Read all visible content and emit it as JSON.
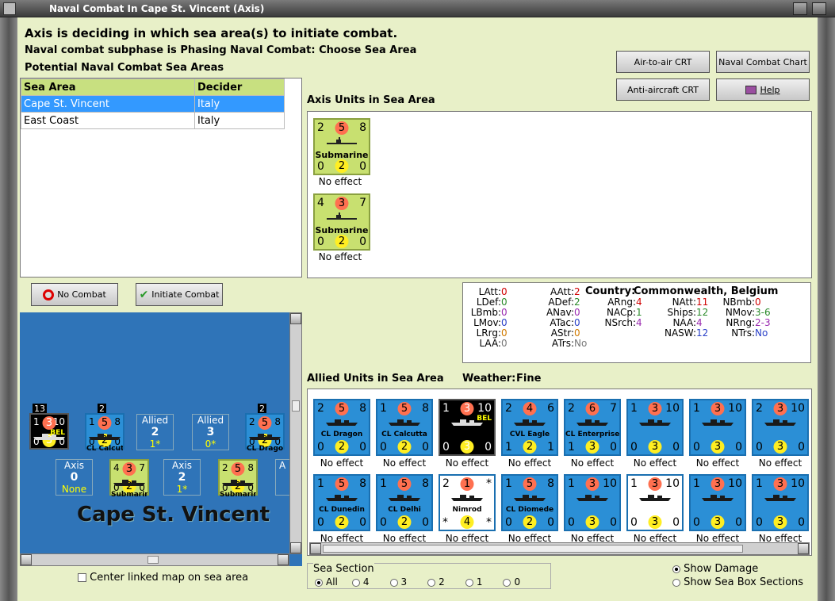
{
  "window": {
    "title": "Naval Combat In Cape St. Vincent (Axis)"
  },
  "header": {
    "line1": "Axis is deciding in which sea area(s) to initiate combat.",
    "line2": "Naval combat subphase is Phasing Naval Combat: Choose Sea Area",
    "line3": "Potential Naval Combat Sea Areas"
  },
  "buttons": {
    "air_to_air": "Air-to-air CRT",
    "naval_chart": "Naval Combat Chart",
    "anti_aircraft": "Anti-aircraft CRT",
    "help": "Help",
    "no_combat": "No Combat",
    "initiate_combat": "Initiate Combat"
  },
  "sea_table": {
    "headers": [
      "Sea Area",
      "Decider"
    ],
    "rows": [
      [
        "Cape St. Vincent",
        "Italy"
      ],
      [
        "East Coast",
        "Italy"
      ]
    ]
  },
  "axis_units": {
    "title": "Axis Units in Sea Area",
    "units": [
      {
        "tl": "2",
        "c": "5",
        "tr": "8",
        "name": "Submarine",
        "bl": "0",
        "cb": "2",
        "br": "0",
        "effect": "No effect"
      },
      {
        "tl": "4",
        "c": "3",
        "tr": "7",
        "name": "Submarine",
        "bl": "0",
        "cb": "2",
        "br": "0",
        "effect": "No effect"
      }
    ]
  },
  "stats": {
    "country_label": "Country:",
    "country": "Commonwealth, Belgium",
    "col1": [
      [
        "LAtt:",
        "0"
      ],
      [
        "LDef:",
        "0"
      ],
      [
        "LBmb:",
        "0"
      ],
      [
        "LMov:",
        "0"
      ],
      [
        "LRrg:",
        "0"
      ],
      [
        "LAA:",
        "0"
      ]
    ],
    "col2": [
      [
        "AAtt:",
        "2"
      ],
      [
        "ADef:",
        "2"
      ],
      [
        "ANav:",
        "0"
      ],
      [
        "ATac:",
        "0"
      ],
      [
        "AStr:",
        "0"
      ],
      [
        "ATrs:",
        "No"
      ]
    ],
    "col3": [
      [
        "ARng:",
        "4"
      ],
      [
        "NACp:",
        "1"
      ],
      [
        "NSrch:",
        "4"
      ]
    ],
    "col4": [
      [
        "NAtt:",
        "11"
      ],
      [
        "Ships:",
        "12"
      ],
      [
        "NAA:",
        "4"
      ],
      [
        "NASW:",
        "12"
      ]
    ],
    "col5": [
      [
        "NBmb:",
        "0"
      ],
      [
        "NMov:",
        "3-6"
      ],
      [
        "NRng:",
        "2-3"
      ],
      [
        "NTrs:",
        "No"
      ]
    ]
  },
  "allied": {
    "title": "Allied Units in Sea Area",
    "weather_label": "Weather:",
    "weather": "Fine",
    "row1": [
      {
        "tl": "2",
        "c": "5",
        "tr": "8",
        "name": "CL Dragon",
        "bl": "0",
        "cb": "2",
        "br": "0",
        "effect": "No effect",
        "style": "blue"
      },
      {
        "tl": "1",
        "c": "5",
        "tr": "8",
        "name": "CL Calcutta",
        "bl": "0",
        "cb": "2",
        "br": "0",
        "effect": "No effect",
        "style": "blue"
      },
      {
        "tl": "1",
        "c": "3",
        "tr": "10",
        "name": "BEL",
        "bl": "0",
        "cb": "3",
        "br": "0",
        "effect": "No effect",
        "style": "dark"
      },
      {
        "tl": "2",
        "c": "4",
        "tr": "6",
        "name": "CVL Eagle",
        "bl": "1",
        "cb": "2",
        "br": "1",
        "effect": "No effect",
        "style": "blue"
      },
      {
        "tl": "2",
        "c": "6",
        "tr": "7",
        "name": "CL Enterprise",
        "bl": "1",
        "cb": "3",
        "br": "0",
        "effect": "No effect",
        "style": "blue"
      },
      {
        "tl": "1",
        "c": "3",
        "tr": "10",
        "name": "",
        "bl": "0",
        "cb": "3",
        "br": "0",
        "effect": "No effect",
        "style": "blue"
      },
      {
        "tl": "1",
        "c": "3",
        "tr": "10",
        "name": "",
        "bl": "0",
        "cb": "3",
        "br": "0",
        "effect": "No effect",
        "style": "blue"
      },
      {
        "tl": "2",
        "c": "3",
        "tr": "10",
        "name": "",
        "bl": "0",
        "cb": "3",
        "br": "0",
        "effect": "No effect",
        "style": "blue"
      }
    ],
    "row2": [
      {
        "tl": "1",
        "c": "5",
        "tr": "8",
        "name": "CL Dunedin",
        "bl": "0",
        "cb": "2",
        "br": "0",
        "effect": "No effect",
        "style": "blue"
      },
      {
        "tl": "1",
        "c": "5",
        "tr": "8",
        "name": "CL Delhi",
        "bl": "0",
        "cb": "2",
        "br": "0",
        "effect": "No effect",
        "style": "blue"
      },
      {
        "tl": "2",
        "c": "1",
        "tr": "*",
        "name": "Nimrod",
        "bl": "*",
        "cb": "4",
        "br": "*",
        "effect": "No effect",
        "style": "white"
      },
      {
        "tl": "1",
        "c": "5",
        "tr": "8",
        "name": "CL Diomede",
        "bl": "0",
        "cb": "2",
        "br": "0",
        "effect": "No effect",
        "style": "blue"
      },
      {
        "tl": "1",
        "c": "3",
        "tr": "10",
        "name": "",
        "bl": "0",
        "cb": "3",
        "br": "0",
        "effect": "No effect",
        "style": "blue"
      },
      {
        "tl": "1",
        "c": "3",
        "tr": "10",
        "name": "",
        "bl": "0",
        "cb": "3",
        "br": "0",
        "effect": "No effect",
        "style": "white"
      },
      {
        "tl": "1",
        "c": "3",
        "tr": "10",
        "name": "",
        "bl": "0",
        "cb": "3",
        "br": "0",
        "effect": "No effect",
        "style": "blue"
      },
      {
        "tl": "1",
        "c": "3",
        "tr": "10",
        "name": "",
        "bl": "0",
        "cb": "3",
        "br": "0",
        "effect": "No effect",
        "style": "blue"
      }
    ]
  },
  "map": {
    "sea_name": "Cape St. Vincent",
    "stack1": "13",
    "stack2": "2",
    "stack3": "2",
    "allied_box1": {
      "label": "Allied",
      "num": "2",
      "sub": "1*"
    },
    "allied_box2": {
      "label": "Allied",
      "num": "3",
      "sub": "0*"
    },
    "axis_box1": {
      "label": "Axis",
      "num": "0",
      "sub": "None"
    },
    "axis_box2": {
      "label": "Axis",
      "num": "2",
      "sub": "1*"
    },
    "axis_box3_partial": "A",
    "unit_bel": {
      "tl": "1",
      "c": "3",
      "tr": "10",
      "name": "BEL",
      "bl": "0",
      "cb": "3",
      "br": "0"
    },
    "unit_calcutta": {
      "tl": "1",
      "c": "5",
      "tr": "8",
      "name": "CL Calcutta",
      "bl": "0",
      "cb": "2",
      "br": "0"
    },
    "unit_dragon": {
      "tl": "2",
      "c": "5",
      "tr": "8",
      "name": "CL Dragon",
      "bl": "0",
      "cb": "2",
      "br": "0"
    },
    "unit_sub1": {
      "tl": "4",
      "c": "3",
      "tr": "7",
      "name": "Submarine",
      "bl": "0",
      "cb": "2",
      "br": "0"
    },
    "unit_sub2": {
      "tl": "2",
      "c": "5",
      "tr": "8",
      "name": "Submarine",
      "bl": "0",
      "cb": "2",
      "br": "0"
    }
  },
  "footer": {
    "center_map": "Center linked map on sea area",
    "sea_section": "Sea Section",
    "sections": [
      "All",
      "4",
      "3",
      "2",
      "1",
      "0"
    ],
    "show_damage": "Show Damage",
    "show_boxes": "Show Sea Box Sections"
  },
  "colors": {
    "bg": "#e8f0c8",
    "unit_blue": "#2b8fd6",
    "sub_green": "#c8e070",
    "sel_blue": "#3399ff",
    "header_green": "#c8e080"
  }
}
